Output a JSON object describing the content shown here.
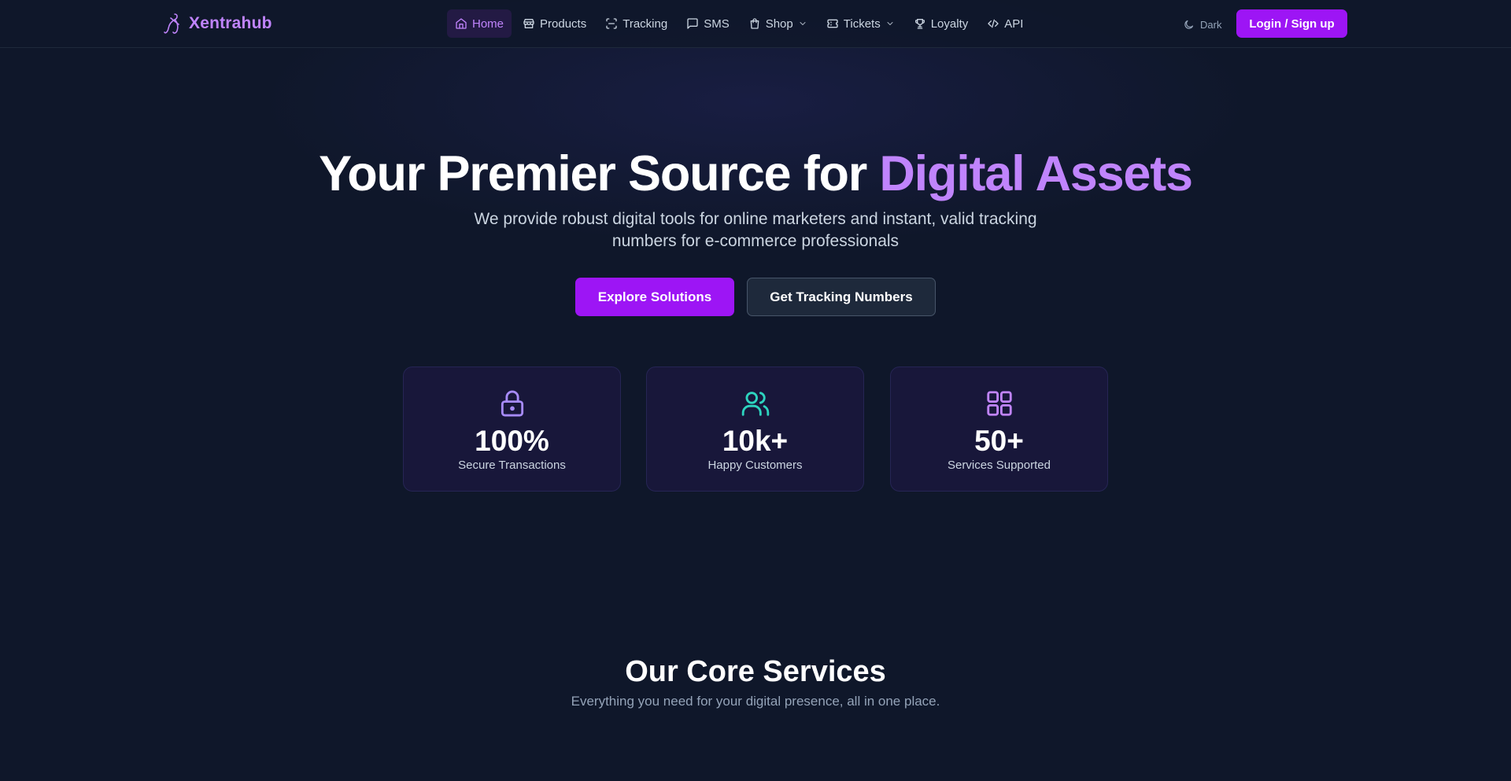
{
  "brand": {
    "name": "Xentrahub",
    "color": "#c084fc"
  },
  "nav": {
    "items": [
      {
        "label": "Home",
        "icon": "home-icon",
        "active": true
      },
      {
        "label": "Products",
        "icon": "store-icon"
      },
      {
        "label": "Tracking",
        "icon": "scan-icon"
      },
      {
        "label": "SMS",
        "icon": "message-icon"
      },
      {
        "label": "Shop",
        "icon": "shopping-bag-icon",
        "dropdown": true
      },
      {
        "label": "Tickets",
        "icon": "ticket-icon",
        "dropdown": true
      },
      {
        "label": "Loyalty",
        "icon": "trophy-icon"
      },
      {
        "label": "API",
        "icon": "code-icon"
      }
    ],
    "theme_label": "Dark",
    "login_label": "Login / Sign up"
  },
  "hero": {
    "title_main": "Your Premier Source for ",
    "title_accent": "Digital Assets",
    "subtitle": "We provide robust digital tools for online marketers and instant, valid tracking numbers for e-commerce professionals",
    "primary_cta": "Explore Solutions",
    "secondary_cta": "Get Tracking Numbers"
  },
  "stats": [
    {
      "value": "100%",
      "label": "Secure Transactions",
      "icon": "lock-icon",
      "color": "#a78bfa"
    },
    {
      "value": "10k+",
      "label": "Happy Customers",
      "icon": "users-icon",
      "color": "#2dd4bf"
    },
    {
      "value": "50+",
      "label": "Services Supported",
      "icon": "grid-icon",
      "color": "#c084fc"
    }
  ],
  "services": {
    "title": "Our Core Services",
    "subtitle": "Everything you need for your digital presence, all in one place."
  },
  "colors": {
    "background": "#0f172a",
    "accent": "#9d15f5",
    "card": "#18173a"
  }
}
